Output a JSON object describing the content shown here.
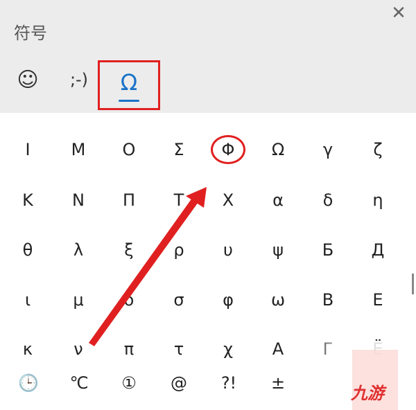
{
  "header": {
    "title": "符号",
    "close_glyph": "✕",
    "tabs": [
      {
        "label": "☺",
        "icon": "emoji-icon"
      },
      {
        "label": ";-)",
        "icon": "kaomoji-icon"
      },
      {
        "label": "Ω",
        "icon": "symbols-icon",
        "selected": true
      }
    ]
  },
  "grid": {
    "rows": [
      [
        "Ι",
        "Μ",
        "Ο",
        "Σ",
        "Φ",
        "Ω",
        "γ",
        "ζ"
      ],
      [
        "Κ",
        "Ν",
        "Π",
        "Τ",
        "Χ",
        "α",
        "δ",
        "η"
      ],
      [
        "θ",
        "λ",
        "ξ",
        "ρ",
        "υ",
        "ψ",
        "Б",
        "Д"
      ],
      [
        "ι",
        "μ",
        "ο",
        "σ",
        "φ",
        "ω",
        "В",
        "Е"
      ],
      [
        "κ",
        "ν",
        "π",
        "τ",
        "χ",
        "А",
        "Г",
        "Ё"
      ]
    ],
    "highlighted": "Φ"
  },
  "bottom_bar": [
    {
      "label": "🕒",
      "icon": "clock-icon"
    },
    {
      "label": "℃"
    },
    {
      "label": "①"
    },
    {
      "label": "@"
    },
    {
      "label": "?!"
    },
    {
      "label": "±"
    }
  ],
  "watermark": "九游",
  "colors": {
    "accent": "#1a73c9",
    "annotation": "#e02020"
  }
}
